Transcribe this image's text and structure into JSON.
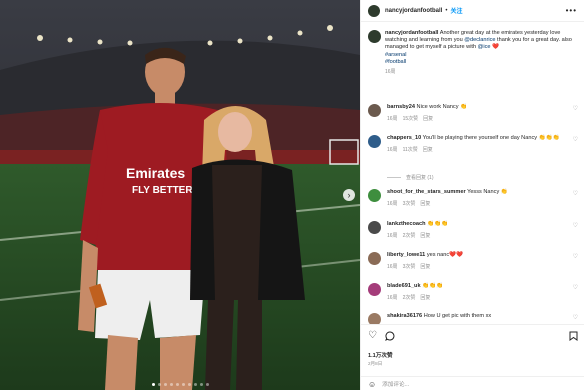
{
  "post": {
    "username": "nancyjordanfootball",
    "separator": "•",
    "follow_label": "关注",
    "more_icon": "more-dots-icon",
    "photo_alt": "",
    "caption": {
      "author": "nancyjordanfootball",
      "text_1": " Another great day at the emirates yesterday love watching and learning from you ",
      "mention_1": "@declanrice",
      "text_2": " thank you for a great day. also managed to get myself a picture with ",
      "mention_2": "@ice",
      "text_3": " ❤️",
      "hashtags": [
        "#arsenal",
        "#football"
      ],
      "time": "16周"
    }
  },
  "comments": [
    {
      "user": "barnsby24",
      "text": "Nice work Nancy 👏",
      "time": "16周",
      "likes": "15次赞",
      "reply": "回复",
      "color": "#6b5a4e"
    },
    {
      "user": "chappers_10",
      "text": "You'll be playing there yourself one day Nancy 👏👏👏",
      "time": "16周",
      "likes": "11次赞",
      "reply": "回复",
      "color": "#2f5d8a"
    },
    {
      "user": "shoot_for_the_stars_summer",
      "text": "Yesss Nancy 👏",
      "time": "16周",
      "likes": "3次赞",
      "reply": "回复",
      "color": "#3e8e3e"
    },
    {
      "user": "lankzthecoach",
      "text": "👏👏👏",
      "time": "16周",
      "likes": "2次赞",
      "reply": "回复",
      "color": "#4a4a4a"
    },
    {
      "user": "liberty_lowe11",
      "text": "yes nanc❤️❤️",
      "time": "16周",
      "likes": "3次赞",
      "reply": "回复",
      "color": "#8a6b56"
    },
    {
      "user": "blade691_uk",
      "text": "👏👏👏",
      "time": "16周",
      "likes": "2次赞",
      "reply": "回复",
      "color": "#a43c7a"
    },
    {
      "user": "shakira36176",
      "text": "How U get pic with them xx",
      "time": "",
      "likes": "",
      "reply": "",
      "color": "#9a7a63"
    }
  ],
  "view_replies": "查看回复 (1)",
  "likes_count": "1.1万次赞",
  "post_date": "2月8日",
  "add_comment_placeholder": "添加评论...",
  "icons": {
    "like": "heart-outline-icon",
    "comment": "comment-bubble-icon",
    "bookmark": "bookmark-icon",
    "emoji": "emoji-icon",
    "next": "chevron-right-icon"
  }
}
